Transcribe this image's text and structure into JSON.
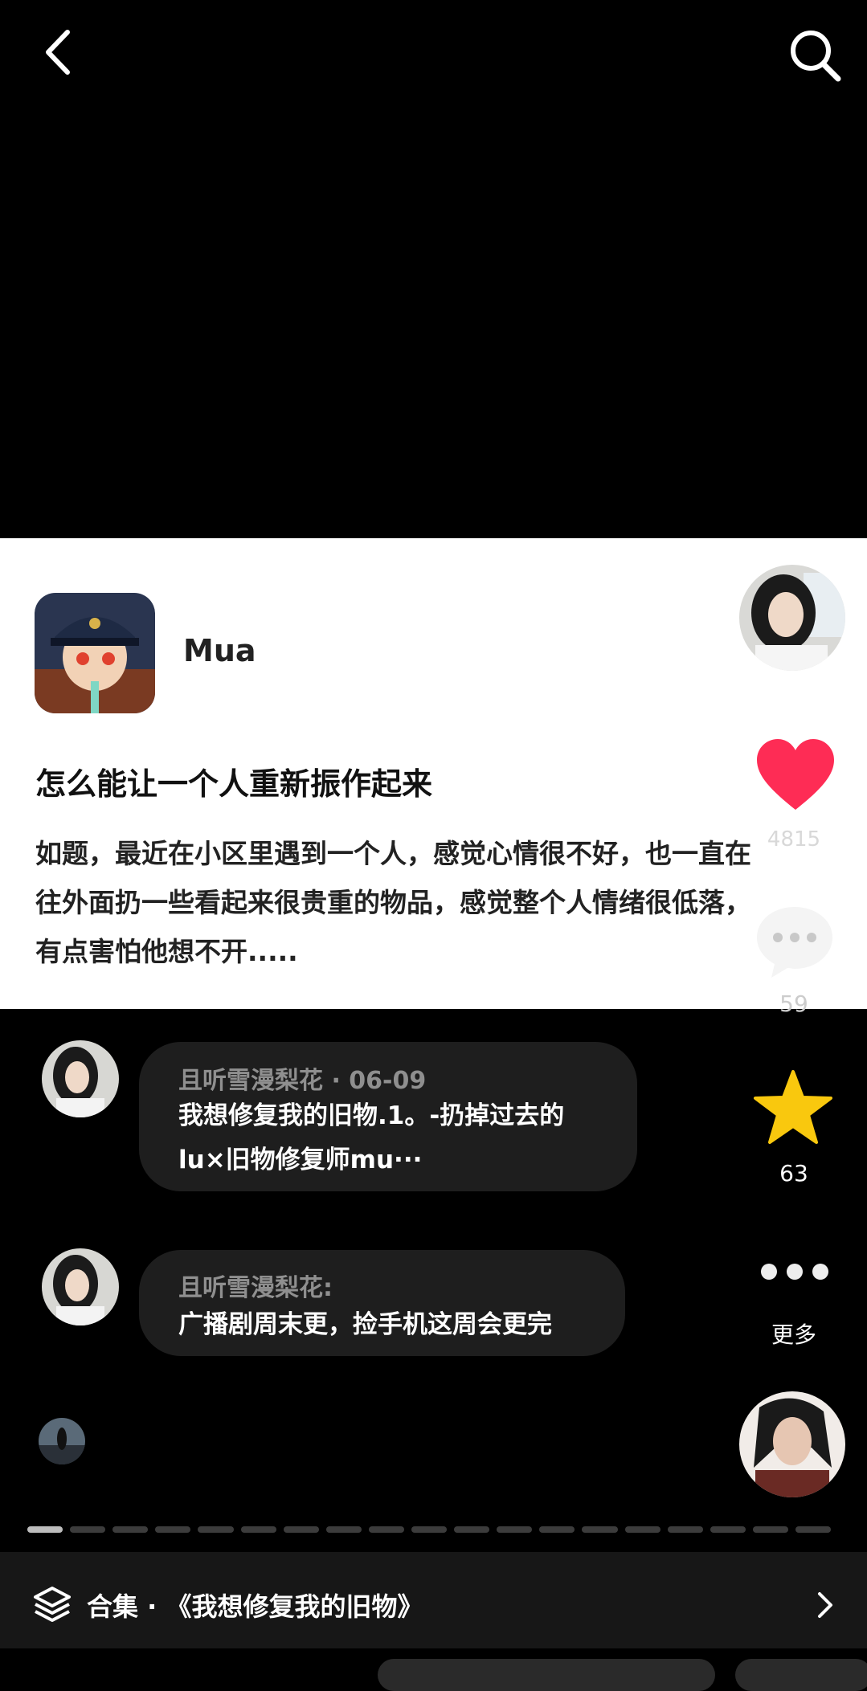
{
  "post": {
    "username": "Mua",
    "title": "怎么能让一个人重新振作起来",
    "body": "如题，最近在小区里遇到一个人，感觉心情很不好，也一直在\n往外面扔一些看起来很贵重的物品，感觉整个人情绪很低落，\n有点害怕他想不开....."
  },
  "actions": {
    "like_count": "4815",
    "comment_count": "59",
    "favorite_count": "63",
    "more_label": "更多"
  },
  "comments": [
    {
      "user": "且听雪漫梨花",
      "date": "06-09",
      "text": "我想修复我的旧物.1。-扔掉过去的\nlu×旧物修复师mu···"
    },
    {
      "user": "且听雪漫梨花:",
      "text": "广播剧周末更，捡手机这周会更完"
    }
  ],
  "collection": {
    "label": "合集 · 《我想修复我的旧物》"
  },
  "progress": {
    "segments": 19,
    "active_index": 0
  },
  "icons": [
    "back-icon",
    "search-icon",
    "heart-icon",
    "comment-icon",
    "star-icon",
    "more-dots-icon",
    "layers-icon",
    "chevron-right-icon"
  ],
  "colors": {
    "like": "#fe2c55",
    "favorite": "#f9c80e"
  }
}
